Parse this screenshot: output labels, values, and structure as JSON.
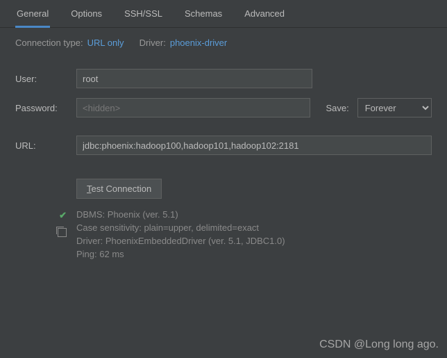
{
  "tabs": {
    "general": "General",
    "options": "Options",
    "sshssl": "SSH/SSL",
    "schemas": "Schemas",
    "advanced": "Advanced"
  },
  "meta": {
    "connection_type_label": "Connection type:",
    "connection_type_value": "URL only",
    "driver_label": "Driver:",
    "driver_value": "phoenix-driver"
  },
  "fields": {
    "user_label": "User:",
    "user_value": "root",
    "password_label": "Password:",
    "password_placeholder": "<hidden>",
    "save_label": "Save:",
    "save_value": "Forever",
    "url_label": "URL:",
    "url_value": "jdbc:phoenix:hadoop100,hadoop101,hadoop102:2181"
  },
  "test": {
    "button_prefix": "T",
    "button_rest": "est Connection",
    "line1": "DBMS: Phoenix (ver. 5.1)",
    "line2": "Case sensitivity: plain=upper, delimited=exact",
    "line3": "Driver: PhoenixEmbeddedDriver (ver. 5.1, JDBC1.0)",
    "line4": "Ping: 62 ms"
  },
  "watermark": "CSDN @Long long ago."
}
